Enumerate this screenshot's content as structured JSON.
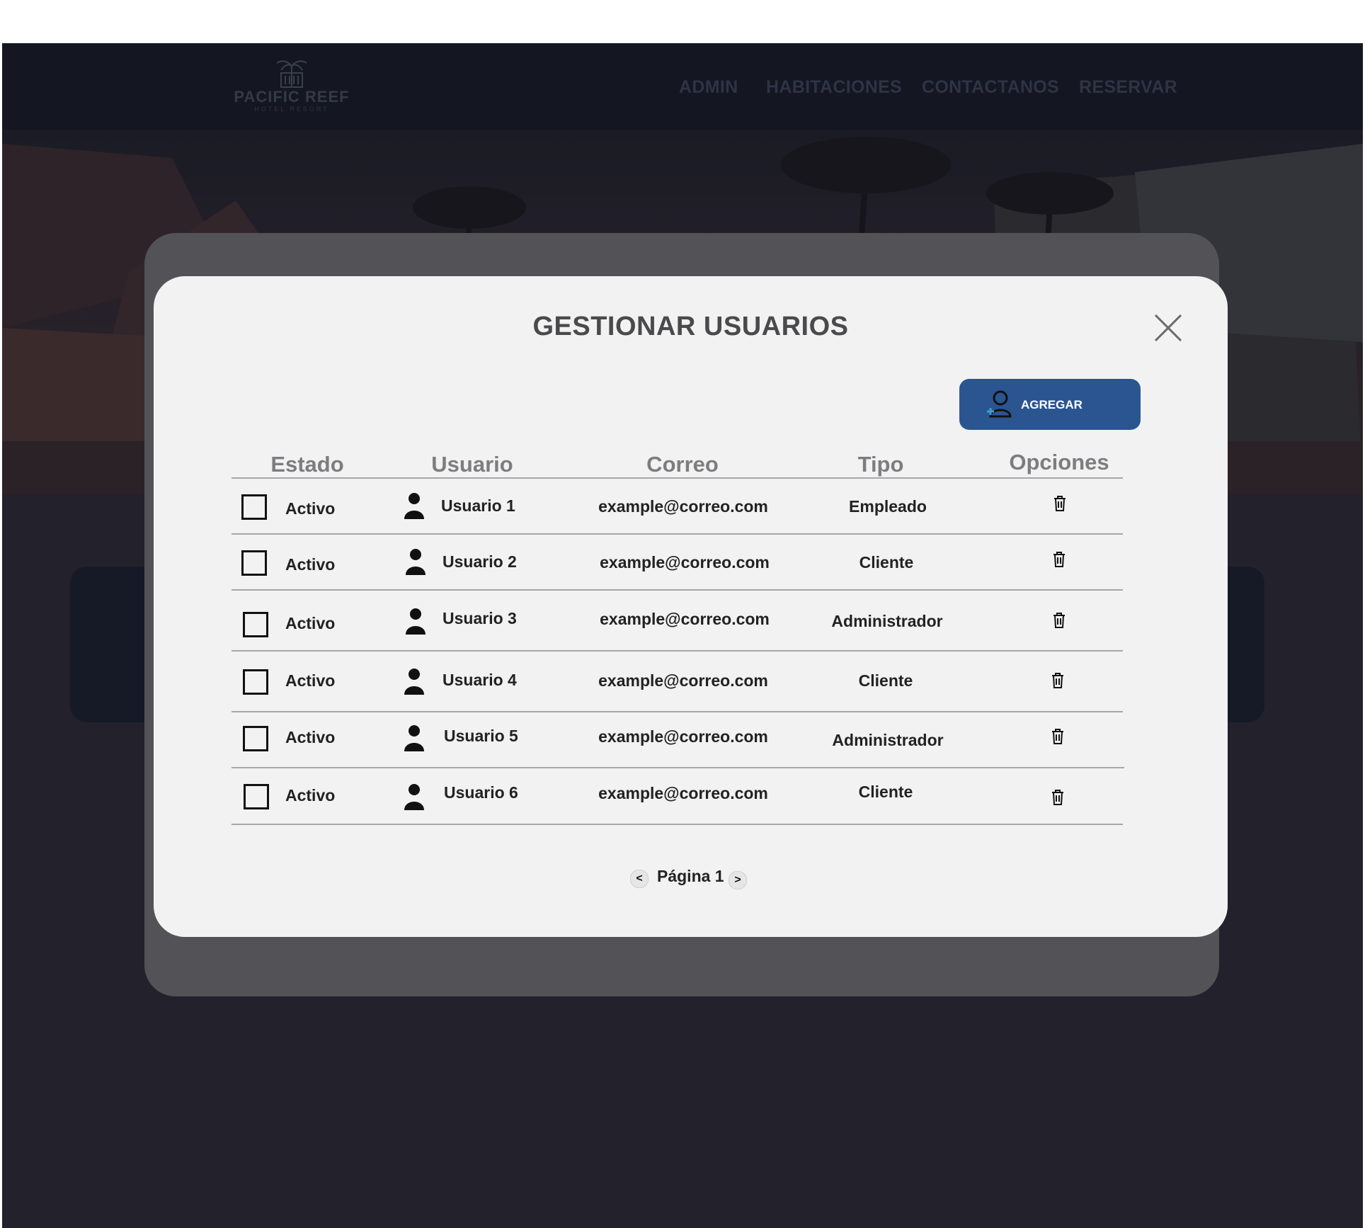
{
  "brand": {
    "name": "PACIFIC REEF",
    "tagline": "HOTEL RESORT"
  },
  "nav": {
    "items": [
      "ADMIN",
      "HABITACIONES",
      "CONTACTANOS",
      "RESERVAR"
    ]
  },
  "modal": {
    "title": "GESTIONAR USUARIOS",
    "close_icon": "close-x",
    "add_button": {
      "label": "AGREGAR",
      "icon": "add-user-icon"
    },
    "table": {
      "headers": [
        "Estado",
        "Usuario",
        "Correo",
        "Tipo",
        "Opciones"
      ],
      "rows": [
        {
          "estado": "Activo",
          "usuario": "Usuario 1",
          "correo": "example@correo.com",
          "tipo": "Empleado"
        },
        {
          "estado": "Activo",
          "usuario": "Usuario 2",
          "correo": "example@correo.com",
          "tipo": "Cliente"
        },
        {
          "estado": "Activo",
          "usuario": "Usuario 3",
          "correo": "example@correo.com",
          "tipo": "Administrador"
        },
        {
          "estado": "Activo",
          "usuario": "Usuario 4",
          "correo": "example@correo.com",
          "tipo": "Cliente"
        },
        {
          "estado": "Activo",
          "usuario": "Usuario 5",
          "correo": "example@correo.com",
          "tipo": "Administrador"
        },
        {
          "estado": "Activo",
          "usuario": "Usuario 6",
          "correo": "example@correo.com",
          "tipo": "Cliente"
        }
      ]
    },
    "pagination": {
      "label": "Página 1",
      "prev": "<",
      "next": ">"
    }
  },
  "colors": {
    "navbar": "#141721",
    "page_background": "#22212c",
    "modal_background": "#f2f2f2",
    "button_primary": "#2b5590",
    "header_text": "#7d7d80",
    "add_icon_accent": "#3aa0d8"
  }
}
